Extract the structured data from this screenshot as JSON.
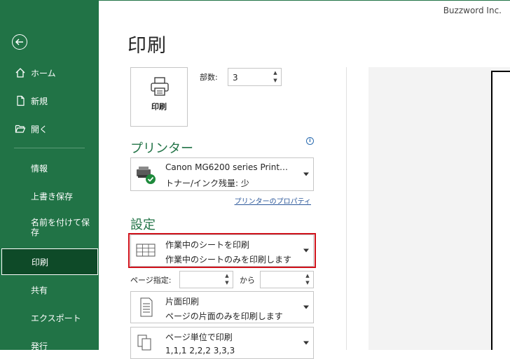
{
  "brand": "Buzzword Inc.",
  "sidebar": {
    "items": [
      {
        "label": "ホーム",
        "icon": "home-icon"
      },
      {
        "label": "新規",
        "icon": "new-document-icon"
      },
      {
        "label": "開く",
        "icon": "open-folder-icon"
      },
      {
        "label": "情報"
      },
      {
        "label": "上書き保存"
      },
      {
        "label": "名前を付けて保存"
      },
      {
        "label": "印刷"
      },
      {
        "label": "共有"
      },
      {
        "label": "エクスポート"
      },
      {
        "label": "発行"
      }
    ],
    "active_index": 6,
    "colors": {
      "background": "#217346",
      "active": "#0e4a28"
    }
  },
  "main": {
    "title": "印刷",
    "print_button": {
      "label": "印刷",
      "icon": "printer-icon"
    },
    "copies": {
      "label": "部数:",
      "value": "3"
    },
    "printer_section": {
      "title": "プリンター",
      "printer_name": "Canon MG6200 series Print…",
      "printer_status": "トナー/インク残量: 少",
      "properties_link": "プリンターのプロパティ",
      "icon": "printer-ready-icon"
    },
    "settings_section": {
      "title": "設定",
      "print_what": {
        "line1": "作業中のシートを印刷",
        "line2": "作業中のシートのみを印刷します",
        "icon": "sheet-grid-icon"
      },
      "pages_label": "ページ指定:",
      "pages_from": "",
      "pages_to_label": "から",
      "pages_to": "",
      "sides": {
        "line1": "片面印刷",
        "line2": "ページの片面のみを印刷します",
        "icon": "one-sided-icon"
      },
      "collate": {
        "line1": "ページ単位で印刷",
        "line2": "1,1,1   2,2,2   3,3,3",
        "icon": "collate-icon"
      }
    },
    "highlight_color": "#d0121b"
  }
}
